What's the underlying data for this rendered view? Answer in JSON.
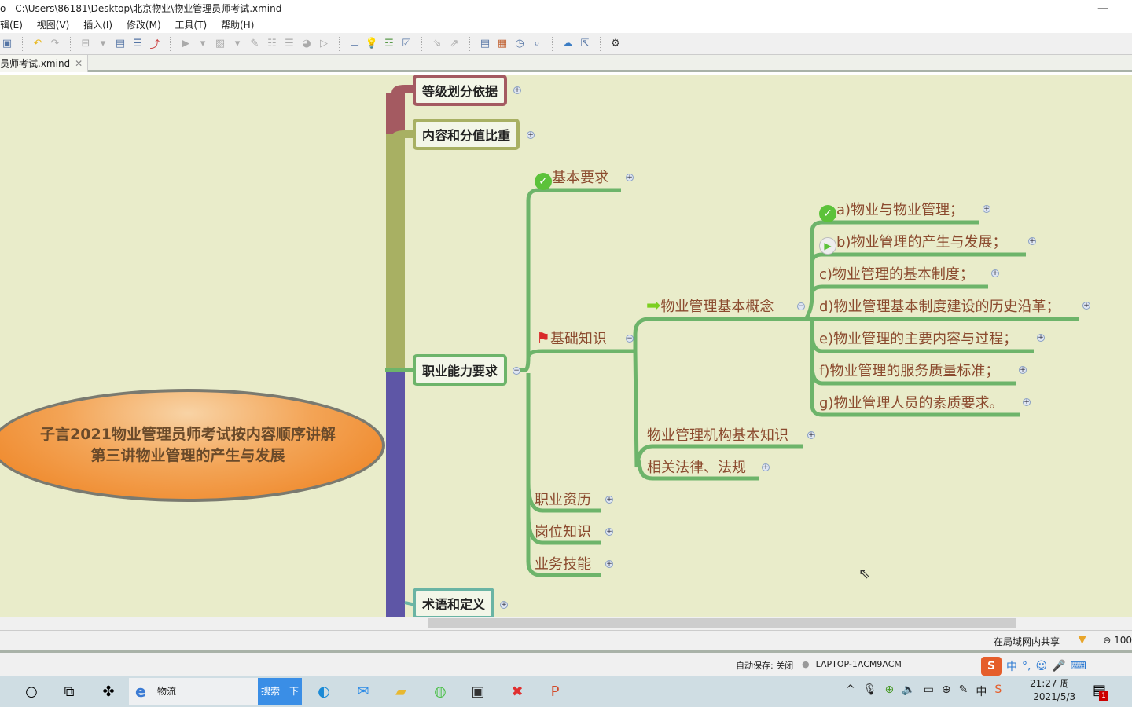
{
  "window": {
    "title": "o - C:\\Users\\86181\\Desktop\\北京物业\\物业管理员师考试.xmind",
    "minimize": "—"
  },
  "menu": [
    "辑(E)",
    "视图(V)",
    "插入(I)",
    "修改(M)",
    "工具(T)",
    "帮助(H)"
  ],
  "tab": {
    "label": "员师考试.xmind",
    "close": "✕"
  },
  "mindmap": {
    "central": {
      "line1": "子言2021物业管理员师考试按内容顺序讲解",
      "line2": "第三讲物业管理的产生与发展"
    },
    "main_topics": [
      {
        "label": "等级划分依据",
        "color": "#a45a61",
        "expander": "+"
      },
      {
        "label": "内容和分值比重",
        "color": "#a8b063",
        "expander": "+"
      },
      {
        "label": "职业能力要求",
        "color": "#6db46a",
        "expander": "−"
      },
      {
        "label": "术语和定义",
        "color": "#6ab4a4",
        "expander": "+"
      }
    ],
    "subtopics": {
      "jiben_yaoqiu": {
        "label": "基本要求",
        "marker": "check-icon",
        "expander": "+"
      },
      "jichu_zhishi": {
        "label": "基础知识",
        "marker": "flag-icon",
        "expander": "−"
      },
      "zhiye_zili": {
        "label": "职业资历",
        "expander": "+"
      },
      "gangwei_zhishi": {
        "label": "岗位知识",
        "expander": "+"
      },
      "yewu_jineng": {
        "label": "业务技能",
        "expander": "+"
      }
    },
    "level3": {
      "gainian": {
        "label": "物业管理基本概念",
        "marker": "arrow-right-icon",
        "expander": "−"
      },
      "jigou": {
        "label": "物业管理机构基本知识",
        "expander": "+"
      },
      "falv": {
        "label": "相关法律、法规",
        "expander": "+"
      }
    },
    "level4": [
      {
        "label": "a)物业与物业管理；",
        "marker": "check-icon",
        "expander": "+"
      },
      {
        "label": "b)物业管理的产生与发展；",
        "marker": "play-icon",
        "expander": "+"
      },
      {
        "label": "c)物业管理的基本制度；",
        "expander": "+"
      },
      {
        "label": "d)物业管理基本制度建设的历史沿革；",
        "expander": "+"
      },
      {
        "label": "e)物业管理的主要内容与过程；",
        "expander": "+"
      },
      {
        "label": "f)物业管理的服务质量标准；",
        "expander": "+"
      },
      {
        "label": "g)物业管理人员的素质要求。",
        "expander": "+"
      }
    ]
  },
  "status": {
    "share": "在局域网内共享",
    "zoom": "⊖ 100",
    "autosave": "自动保存: 关闭",
    "host": "LAPTOP-1ACM9ACM"
  },
  "ime": [
    "中",
    "°,",
    "☺",
    "🎤",
    "⌨"
  ],
  "taskbar": {
    "search_text": "物流",
    "search_button": "搜索一下",
    "time": "21:27 周一",
    "date": "2021/5/3",
    "notifications": "1"
  },
  "colors": {
    "canvas_bg": "#e9ecca",
    "branch_green": "#6db46a",
    "text_brown": "#8b4a2e",
    "purple_branch": "#5e56a6"
  }
}
